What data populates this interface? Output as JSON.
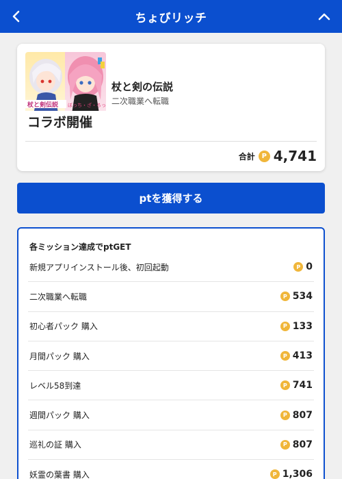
{
  "header": {
    "title": "ちょびリッチ",
    "back_icon": "chevron-left-icon",
    "collapse_icon": "chevron-up-icon",
    "color": "#0b4fcf"
  },
  "game": {
    "title": "杖と剣の伝説",
    "subtitle": "二次職業へ転職",
    "thumbnail_text_top": "杖と剣伝説",
    "thumbnail_text_collab": "ぼっち・ざ・ろっく！",
    "thumbnail_text_bottom": "コラボ開催",
    "total_label": "合計",
    "total_value": "4,741",
    "coin_symbol": "P"
  },
  "cta": {
    "label": "ptを獲得する"
  },
  "missions": {
    "header": "各ミッション達成でptGET",
    "items": [
      {
        "name": "新規アプリインストール後、初回起動",
        "value": "0"
      },
      {
        "name": "二次職業へ転職",
        "value": "534"
      },
      {
        "name": "初心者パック 購入",
        "value": "133"
      },
      {
        "name": "月間パック 購入",
        "value": "413"
      },
      {
        "name": "レベル58到達",
        "value": "741"
      },
      {
        "name": "週間パック 購入",
        "value": "807"
      },
      {
        "name": "巡礼の証 購入",
        "value": "807"
      },
      {
        "name": "妖霊の葉書 購入",
        "value": "1,306"
      }
    ]
  },
  "colors": {
    "brand_blue": "#0b4fcf",
    "coin": "#f0b63a"
  }
}
